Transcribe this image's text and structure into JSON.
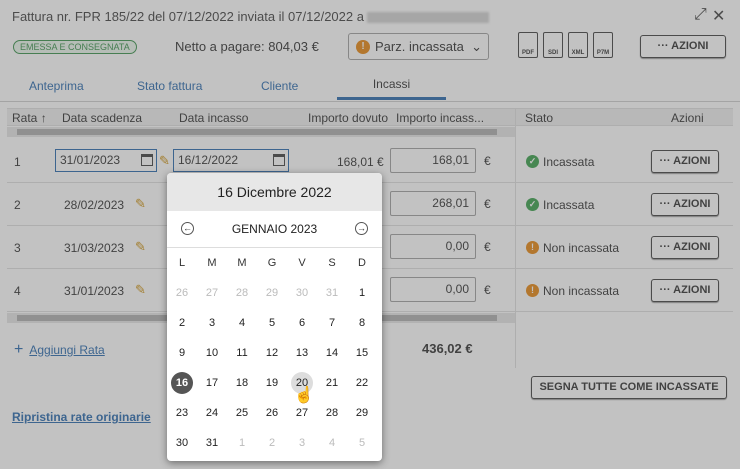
{
  "header": {
    "title": "Fattura nr. FPR 185/22 del 07/12/2022 inviata il 07/12/2022 a",
    "badge": "EMESSA E CONSEGNATA",
    "netto": "Netto a pagare: 804,03 €",
    "status_select": "Parz. incassata",
    "file_icons": [
      "PDF",
      "SDI",
      "XML",
      "P7M"
    ],
    "azioni": "··· AZIONI",
    "expand_icon": "⤢",
    "close_icon": "✕"
  },
  "tabs": [
    "Anteprima",
    "Stato fattura",
    "Cliente",
    "Incassi"
  ],
  "active_tab": "Incassi",
  "table": {
    "headers": [
      "Rata",
      "Data scadenza",
      "Data incasso",
      "Importo dovuto",
      "Importo incass...",
      "Stato",
      "Azioni"
    ],
    "sort_indicator": "↑",
    "rows": [
      {
        "rata": "1",
        "scadenza": "31/01/2023",
        "incasso": "16/12/2022",
        "dovuto": "168,01 €",
        "incassato": "168,01",
        "euro": "€",
        "stato": "Incassata",
        "azioni": "··· AZIONI"
      },
      {
        "rata": "2",
        "scadenza": "28/02/2023",
        "incasso": "",
        "dovuto": "",
        "incassato": "268,01",
        "euro": "€",
        "stato": "Incassata",
        "azioni": "··· AZIONI"
      },
      {
        "rata": "3",
        "scadenza": "31/03/2023",
        "incasso": "",
        "dovuto": "",
        "incassato": "0,00",
        "euro": "€",
        "stato": "Non incassata",
        "azioni": "··· AZIONI"
      },
      {
        "rata": "4",
        "scadenza": "31/01/2023",
        "incasso": "",
        "dovuto": "",
        "incassato": "0,00",
        "euro": "€",
        "stato": "Non incassata",
        "azioni": "··· AZIONI"
      }
    ],
    "add_rata": "Aggiungi Rata",
    "add_icon": "+",
    "total": "436,02 €",
    "segna_tutte": "SEGNA TUTTE COME INCASSATE",
    "ripristina": "Ripristina rate originarie"
  },
  "calendar": {
    "selected_label": "16 Dicembre 2022",
    "month_label": "GENNAIO 2023",
    "prev_icon": "←",
    "next_icon": "→",
    "weekdays": [
      "L",
      "M",
      "M",
      "G",
      "V",
      "S",
      "D"
    ],
    "weeks": [
      [
        "26",
        "27",
        "28",
        "29",
        "30",
        "31",
        "1"
      ],
      [
        "2",
        "3",
        "4",
        "5",
        "6",
        "7",
        "8"
      ],
      [
        "9",
        "10",
        "11",
        "12",
        "13",
        "14",
        "15"
      ],
      [
        "16",
        "17",
        "18",
        "19",
        "20",
        "21",
        "22"
      ],
      [
        "23",
        "24",
        "25",
        "26",
        "27",
        "28",
        "29"
      ],
      [
        "30",
        "31",
        "1",
        "2",
        "3",
        "4",
        "5"
      ]
    ],
    "selected_day": "16",
    "hover_day": "20"
  },
  "colors": {
    "accent": "#1a5fa8",
    "ok": "#2b9a3e",
    "warn": "#e67e00"
  }
}
